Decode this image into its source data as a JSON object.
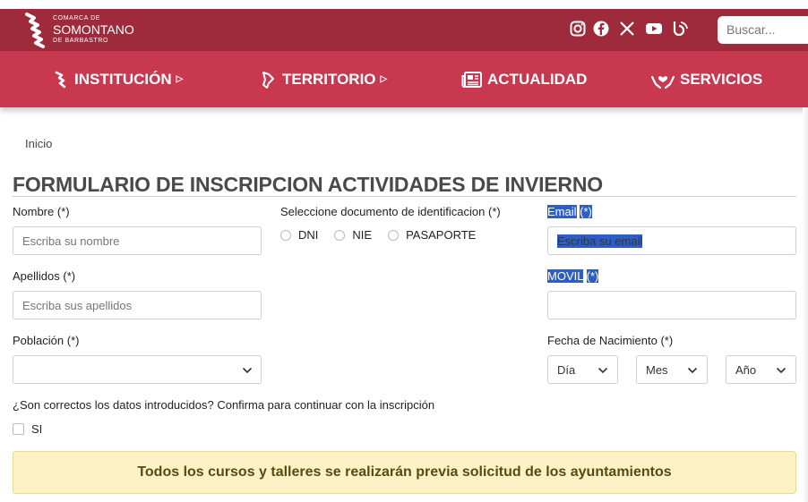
{
  "header": {
    "logo": {
      "line1": "COMARCA DE",
      "line2": "SOMONTANO",
      "line3": "DE BARBASTRO"
    },
    "social_icons": [
      "instagram-icon",
      "facebook-icon",
      "x-icon",
      "youtube-icon",
      "blog-icon"
    ],
    "search": {
      "placeholder": "Buscar..."
    },
    "colors": {
      "topbar": "#9e2a3b",
      "nav": "#c8384f"
    }
  },
  "nav": {
    "items": [
      {
        "label": "INSTITUCIÓN",
        "icon": "institution-icon",
        "has_submenu": true
      },
      {
        "label": "TERRITORIO",
        "icon": "territory-icon",
        "has_submenu": true
      },
      {
        "label": "ACTUALIDAD",
        "icon": "newspaper-icon",
        "has_submenu": false
      },
      {
        "label": "SERVICIOS",
        "icon": "services-icon",
        "has_submenu": false
      }
    ]
  },
  "breadcrumb": {
    "home": "Inicio"
  },
  "form": {
    "title": "FORMULARIO DE INSCRIPCION ACTIVIDADES DE INVIERNO",
    "nombre": {
      "label": "Nombre",
      "required": "(*)",
      "placeholder": "Escriba su nombre"
    },
    "apellidos": {
      "label": "Apellidos",
      "required": "(*)",
      "placeholder": "Escriba sus apellidos"
    },
    "poblacion": {
      "label": "Población",
      "required": "(*)",
      "value": ""
    },
    "documento": {
      "label": "Seleccione documento de identificacion",
      "required": "(*)",
      "options": [
        "DNI",
        "NIE",
        "PASAPORTE"
      ]
    },
    "email": {
      "label": "Email",
      "required": "(*)",
      "placeholder": "Escriba su email"
    },
    "movil": {
      "label": "MOVIL",
      "required": "(*)",
      "value": ""
    },
    "fecha": {
      "label": "Fecha de Nacimiento",
      "required": "(*)",
      "dia": "Día",
      "mes": "Mes",
      "anio": "Año"
    },
    "confirm": {
      "question": "¿Son correctos los datos introducidos? Confirma para continuar con la inscripción",
      "option": "SI",
      "checked": false
    }
  },
  "notice": {
    "text": "Todos los cursos y talleres se realizarán previa solicitud de los ayuntamientos",
    "bg": "#fdf2c5"
  }
}
